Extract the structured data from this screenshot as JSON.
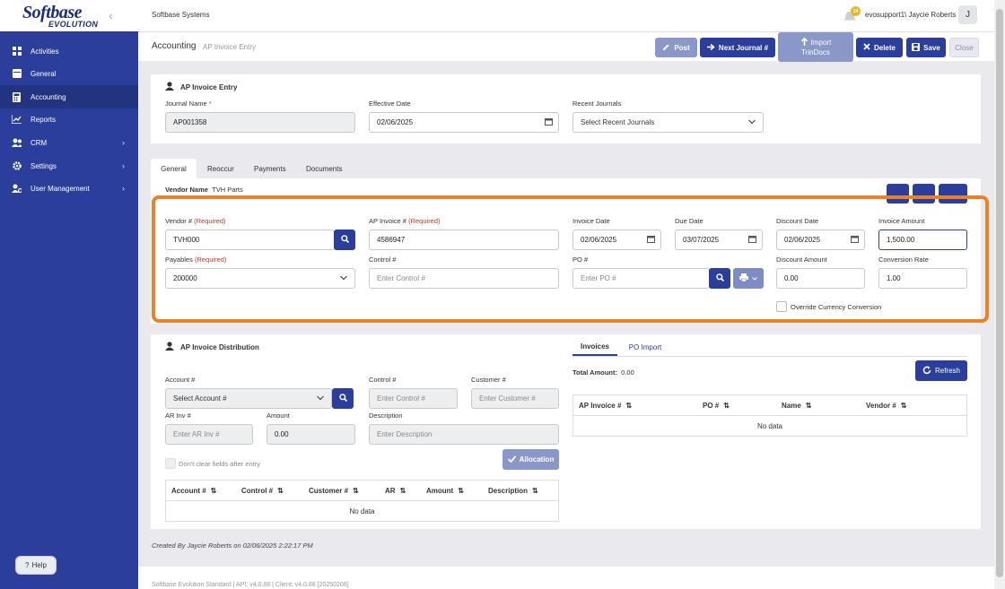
{
  "app": {
    "logo_line1": "Softbase",
    "logo_line2": "EVOLUTION",
    "company": "Softbase Systems",
    "notif_count": "14",
    "user": "evosupport1\\ Jaycie Roberts",
    "avatar_letter": "J",
    "help_label": "Help",
    "footer": "Softbase Evolution Standard | API: v4.0.88 | Client: v4.0.88 [20250206]"
  },
  "sidebar": {
    "items": [
      {
        "label": "Activities",
        "icon": "grid-icon"
      },
      {
        "label": "General",
        "icon": "table-icon"
      },
      {
        "label": "Accounting",
        "icon": "calculator-icon"
      },
      {
        "label": "Reports",
        "icon": "chart-icon"
      },
      {
        "label": "CRM",
        "icon": "users-icon"
      },
      {
        "label": "Settings",
        "icon": "gear-icon"
      },
      {
        "label": "User Management",
        "icon": "user-cog-icon"
      }
    ]
  },
  "header": {
    "title": "Accounting",
    "subtitle": "AP Invoice Entry",
    "buttons": {
      "post": "Post",
      "next_journal": "Next Journal #",
      "import_line1": "Import",
      "import_line2": "TrinDocs",
      "delete": "Delete",
      "save": "Save",
      "close": "Close"
    }
  },
  "entry": {
    "title": "AP Invoice Entry",
    "journal_name_label": "Journal Name",
    "required_star": "*",
    "journal_name_value": "AP001358",
    "effective_date_label": "Effective Date",
    "effective_date_value": "02/06/2025",
    "recent_journals_label": "Recent Journals",
    "recent_journals_placeholder": "Select Recent Journals"
  },
  "tabs": [
    "General",
    "Reoccur",
    "Payments",
    "Documents"
  ],
  "vendor": {
    "vendor_name_label": "Vendor Name",
    "vendor_name_value": "TVH Parts",
    "vendor_no_label": "Vendor #",
    "required": "(Required)",
    "vendor_no_value": "TVH000",
    "ap_invoice_label": "AP Invoice #",
    "ap_invoice_value": "4586947",
    "invoice_date_label": "Invoice Date",
    "invoice_date_value": "02/06/2025",
    "due_date_label": "Due Date",
    "due_date_value": "03/07/2025",
    "discount_date_label": "Discount Date",
    "discount_date_value": "02/06/2025",
    "invoice_amount_label": "Invoice Amount",
    "invoice_amount_value": "1,500.00",
    "payables_label": "Payables",
    "payables_value": "200000",
    "control_label": "Control #",
    "control_placeholder": "Enter Control #",
    "po_label": "PO #",
    "po_placeholder": "Enter PO #",
    "discount_amount_label": "Discount Amount",
    "discount_amount_value": "0.00",
    "conversion_rate_label": "Conversion Rate",
    "conversion_rate_value": "1.00",
    "override_label": "Override Currency Conversion"
  },
  "distribution": {
    "title": "AP Invoice Distribution",
    "account_label": "Account #",
    "account_placeholder": "Select Account #",
    "control_label": "Control #",
    "control_placeholder": "Enter Control #",
    "customer_label": "Customer #",
    "customer_placeholder": "Enter Customer #",
    "ar_inv_label": "AR Inv #",
    "ar_inv_placeholder": "Enter AR Inv #",
    "amount_label": "Amount",
    "amount_value": "0.00",
    "description_label": "Description",
    "description_placeholder": "Enter Description",
    "dont_clear_label": "Don't clear fields after entry",
    "allocation_label": "Allocation",
    "columns": [
      "Account #",
      "Control #",
      "Customer #",
      "AR",
      "Amount",
      "Description"
    ],
    "no_data": "No data"
  },
  "invoices_panel": {
    "tabs": [
      "Invoices",
      "PO Import"
    ],
    "total_label": "Total Amount:",
    "total_value": "0.00",
    "refresh_label": "Refresh",
    "columns": [
      "AP Invoice #",
      "PO #",
      "Name",
      "Vendor #"
    ],
    "no_data": "No data"
  },
  "created": {
    "text": "Created By  Jaycie Roberts on 02/06/2025 2:22:17 PM"
  },
  "colors": {
    "sidebar": "#2b3e9b",
    "accent": "#2b3e9b",
    "highlight": "#e8812a"
  }
}
